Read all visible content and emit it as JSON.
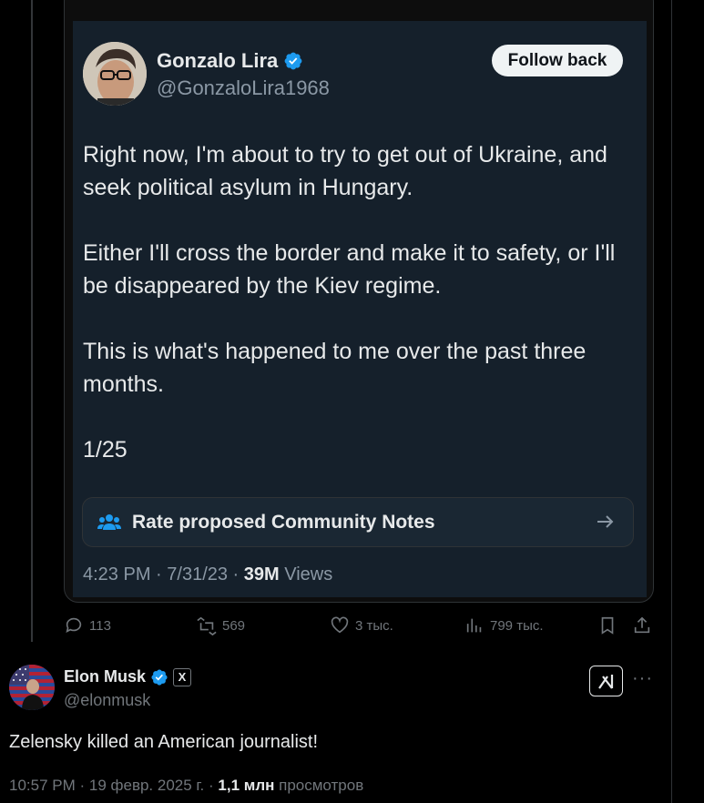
{
  "quoted_tweet": {
    "author_name": "Gonzalo Lira",
    "author_handle": "@GonzaloLira1968",
    "follow_label": "Follow back",
    "paragraphs": [
      "Right now, I'm about to try to get out of Ukraine, and seek political asylum in Hungary.",
      "Either I'll cross the border and make it to safety, or I'll be disappeared by the Kiev regime.",
      "This is what's happened to me over the past three months.",
      "1/25"
    ],
    "community_notes_label": "Rate proposed Community Notes",
    "time": "4:23 PM",
    "date": "7/31/23",
    "views_count": "39M",
    "views_label": "Views"
  },
  "actions": {
    "replies": "113",
    "reposts": "569",
    "likes": "3 тыс.",
    "views": "799 тыс."
  },
  "main_tweet": {
    "author_name": "Elon Musk",
    "author_handle": "@elonmusk",
    "affiliate_badge": "X",
    "text": "Zelensky killed an American journalist!",
    "time": "10:57 PM",
    "date": "19 февр. 2025 г.",
    "views_count": "1,1 млн",
    "views_label": "просмотров"
  },
  "colors": {
    "background": "#000000",
    "card": "#15202b",
    "text": "#e7e9ea",
    "muted": "#71767b",
    "verified": "#1d9bf0"
  },
  "icons": [
    "verified-badge-icon",
    "community-notes-icon",
    "arrow-right-icon",
    "reply-icon",
    "repost-icon",
    "like-icon",
    "views-icon",
    "bookmark-icon",
    "share-icon",
    "grok-icon",
    "more-icon"
  ]
}
